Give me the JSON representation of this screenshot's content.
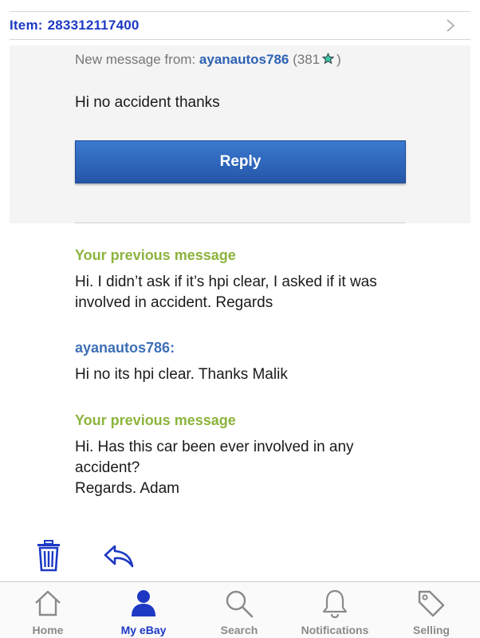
{
  "header": {
    "item_label": "Item:",
    "item_number": "283312117400"
  },
  "new_message": {
    "prefix": "New message from:",
    "sender": "ayanautos786",
    "score_open": "(381",
    "score_close": ")",
    "body": "Hi no accident thanks",
    "reply_label": "Reply"
  },
  "thread": [
    {
      "heading": "Your previous message",
      "lines": [
        "Hi. I didn’t ask if it’s hpi clear, I asked if it was",
        "involved in accident. Regards"
      ]
    },
    {
      "heading": "ayanautos786:",
      "lines": [
        "Hi no its hpi clear. Thanks Malik"
      ]
    },
    {
      "heading": "Your previous message",
      "lines": [
        "Hi. Has this car been ever involved in any",
        "accident?",
        "Regards. Adam"
      ]
    }
  ],
  "tabs": {
    "home": "Home",
    "my_ebay": "My eBay",
    "search": "Search",
    "notifications": "Notifications",
    "selling": "Selling"
  },
  "icons": {
    "chevron": "chevron-right-icon",
    "star": "star-icon",
    "trash": "trash-icon",
    "reply": "reply-arrow-icon"
  },
  "colors": {
    "ebay_blue": "#1d39c4",
    "sender_blue": "#2d62b3",
    "previous_green": "#8cb43d",
    "button_blue": "#2d66bd",
    "star_teal": "#3cc6a9"
  }
}
